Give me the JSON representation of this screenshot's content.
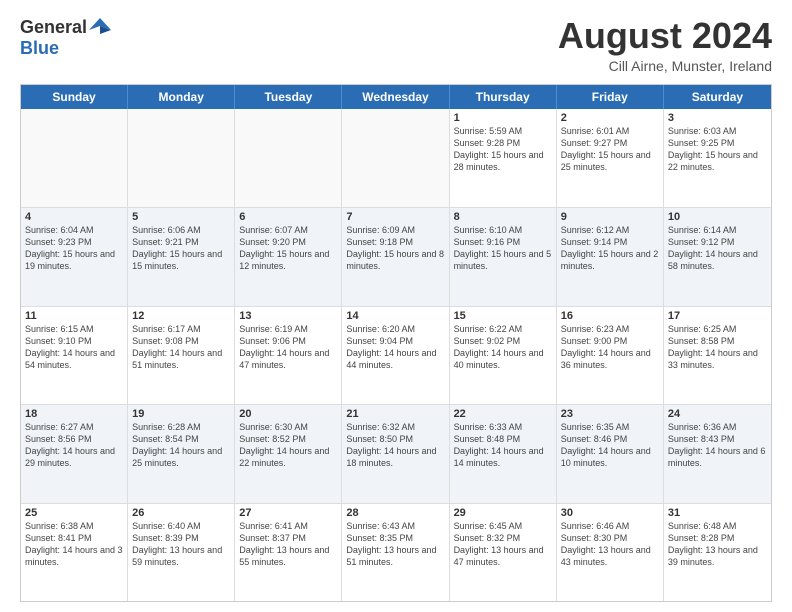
{
  "header": {
    "logo": {
      "general": "General",
      "blue": "Blue"
    },
    "title": "August 2024",
    "subtitle": "Cill Airne, Munster, Ireland"
  },
  "dayHeaders": [
    "Sunday",
    "Monday",
    "Tuesday",
    "Wednesday",
    "Thursday",
    "Friday",
    "Saturday"
  ],
  "weeks": [
    [
      {
        "day": "",
        "empty": true
      },
      {
        "day": "",
        "empty": true
      },
      {
        "day": "",
        "empty": true
      },
      {
        "day": "",
        "empty": true
      },
      {
        "day": "1",
        "info": "Sunrise: 5:59 AM\nSunset: 9:28 PM\nDaylight: 15 hours\nand 28 minutes."
      },
      {
        "day": "2",
        "info": "Sunrise: 6:01 AM\nSunset: 9:27 PM\nDaylight: 15 hours\nand 25 minutes."
      },
      {
        "day": "3",
        "info": "Sunrise: 6:03 AM\nSunset: 9:25 PM\nDaylight: 15 hours\nand 22 minutes."
      }
    ],
    [
      {
        "day": "4",
        "info": "Sunrise: 6:04 AM\nSunset: 9:23 PM\nDaylight: 15 hours\nand 19 minutes."
      },
      {
        "day": "5",
        "info": "Sunrise: 6:06 AM\nSunset: 9:21 PM\nDaylight: 15 hours\nand 15 minutes."
      },
      {
        "day": "6",
        "info": "Sunrise: 6:07 AM\nSunset: 9:20 PM\nDaylight: 15 hours\nand 12 minutes."
      },
      {
        "day": "7",
        "info": "Sunrise: 6:09 AM\nSunset: 9:18 PM\nDaylight: 15 hours\nand 8 minutes."
      },
      {
        "day": "8",
        "info": "Sunrise: 6:10 AM\nSunset: 9:16 PM\nDaylight: 15 hours\nand 5 minutes."
      },
      {
        "day": "9",
        "info": "Sunrise: 6:12 AM\nSunset: 9:14 PM\nDaylight: 15 hours\nand 2 minutes."
      },
      {
        "day": "10",
        "info": "Sunrise: 6:14 AM\nSunset: 9:12 PM\nDaylight: 14 hours\nand 58 minutes."
      }
    ],
    [
      {
        "day": "11",
        "info": "Sunrise: 6:15 AM\nSunset: 9:10 PM\nDaylight: 14 hours\nand 54 minutes."
      },
      {
        "day": "12",
        "info": "Sunrise: 6:17 AM\nSunset: 9:08 PM\nDaylight: 14 hours\nand 51 minutes."
      },
      {
        "day": "13",
        "info": "Sunrise: 6:19 AM\nSunset: 9:06 PM\nDaylight: 14 hours\nand 47 minutes."
      },
      {
        "day": "14",
        "info": "Sunrise: 6:20 AM\nSunset: 9:04 PM\nDaylight: 14 hours\nand 44 minutes."
      },
      {
        "day": "15",
        "info": "Sunrise: 6:22 AM\nSunset: 9:02 PM\nDaylight: 14 hours\nand 40 minutes."
      },
      {
        "day": "16",
        "info": "Sunrise: 6:23 AM\nSunset: 9:00 PM\nDaylight: 14 hours\nand 36 minutes."
      },
      {
        "day": "17",
        "info": "Sunrise: 6:25 AM\nSunset: 8:58 PM\nDaylight: 14 hours\nand 33 minutes."
      }
    ],
    [
      {
        "day": "18",
        "info": "Sunrise: 6:27 AM\nSunset: 8:56 PM\nDaylight: 14 hours\nand 29 minutes."
      },
      {
        "day": "19",
        "info": "Sunrise: 6:28 AM\nSunset: 8:54 PM\nDaylight: 14 hours\nand 25 minutes."
      },
      {
        "day": "20",
        "info": "Sunrise: 6:30 AM\nSunset: 8:52 PM\nDaylight: 14 hours\nand 22 minutes."
      },
      {
        "day": "21",
        "info": "Sunrise: 6:32 AM\nSunset: 8:50 PM\nDaylight: 14 hours\nand 18 minutes."
      },
      {
        "day": "22",
        "info": "Sunrise: 6:33 AM\nSunset: 8:48 PM\nDaylight: 14 hours\nand 14 minutes."
      },
      {
        "day": "23",
        "info": "Sunrise: 6:35 AM\nSunset: 8:46 PM\nDaylight: 14 hours\nand 10 minutes."
      },
      {
        "day": "24",
        "info": "Sunrise: 6:36 AM\nSunset: 8:43 PM\nDaylight: 14 hours\nand 6 minutes."
      }
    ],
    [
      {
        "day": "25",
        "info": "Sunrise: 6:38 AM\nSunset: 8:41 PM\nDaylight: 14 hours\nand 3 minutes."
      },
      {
        "day": "26",
        "info": "Sunrise: 6:40 AM\nSunset: 8:39 PM\nDaylight: 13 hours\nand 59 minutes."
      },
      {
        "day": "27",
        "info": "Sunrise: 6:41 AM\nSunset: 8:37 PM\nDaylight: 13 hours\nand 55 minutes."
      },
      {
        "day": "28",
        "info": "Sunrise: 6:43 AM\nSunset: 8:35 PM\nDaylight: 13 hours\nand 51 minutes."
      },
      {
        "day": "29",
        "info": "Sunrise: 6:45 AM\nSunset: 8:32 PM\nDaylight: 13 hours\nand 47 minutes."
      },
      {
        "day": "30",
        "info": "Sunrise: 6:46 AM\nSunset: 8:30 PM\nDaylight: 13 hours\nand 43 minutes."
      },
      {
        "day": "31",
        "info": "Sunrise: 6:48 AM\nSunset: 8:28 PM\nDaylight: 13 hours\nand 39 minutes."
      }
    ]
  ]
}
